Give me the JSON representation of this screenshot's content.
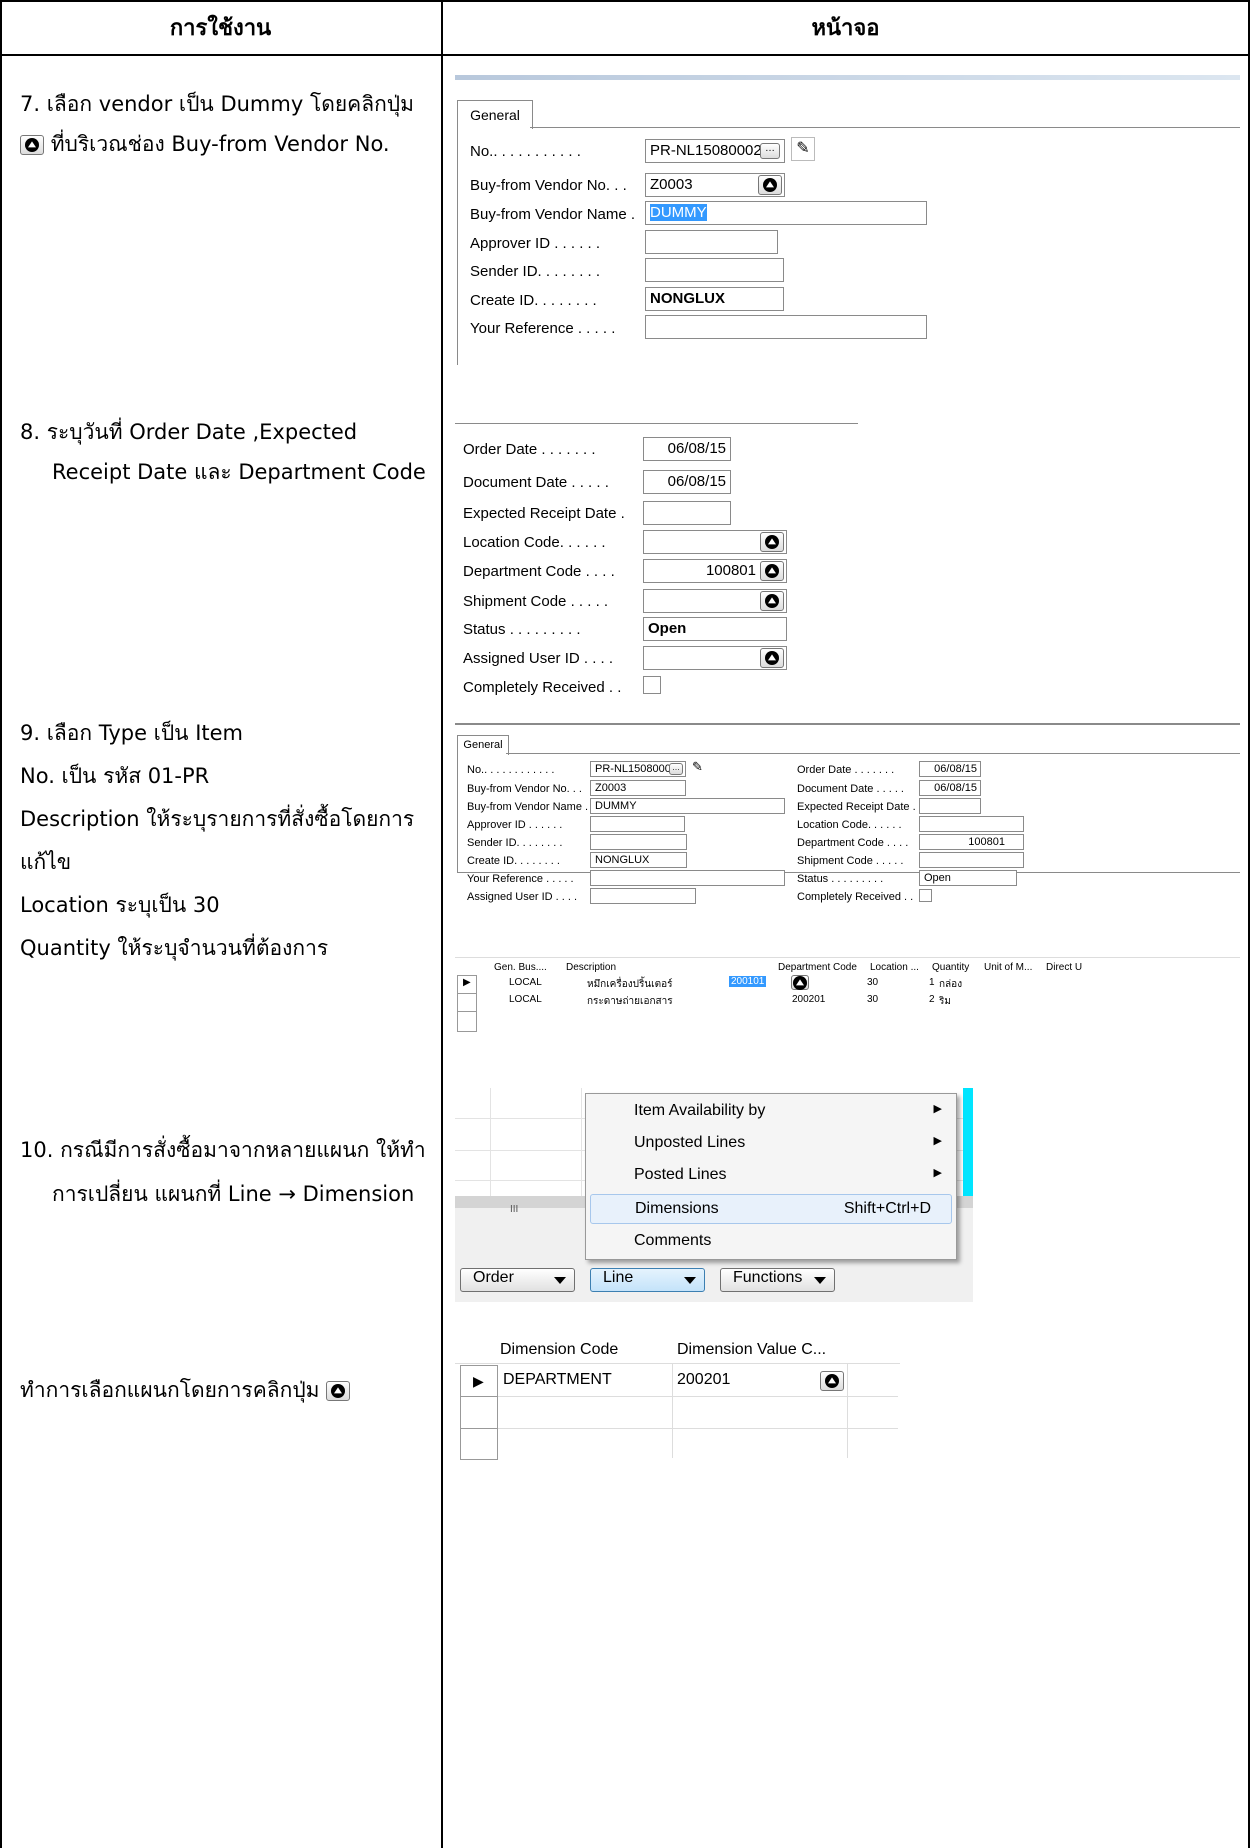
{
  "header": {
    "col1": "การใช้งาน",
    "col2": "หน้าจอ"
  },
  "steps": {
    "s7_line1": "7.  เลือก vendor เป็น Dummy โดยคลิกปุ่ม",
    "s7_line2": "ที่บริเวณช่อง Buy-from Vendor No.",
    "s8_line1": "8.  ระบุวันที่ Order Date ,Expected",
    "s8_line2": "Receipt Date และ Department Code",
    "s9_line1": "9.  เลือก Type เป็น Item",
    "s9_line2": "No. เป็น รหัส 01-PR",
    "s9_line3": "Description ให้ระบุรายการที่สั่งซื้อโดยการ",
    "s9_line4": "แก้ไข",
    "s9_line5": "Location ระบุเป็น 30",
    "s9_line6": "Quantity ให้ระบุจำนวนที่ต้องการ",
    "s10_line1": "10. กรณีมีการสั่งซื้อมาจากหลายแผนก ให้ทำ",
    "s10_line2": "การเปลี่ยน แผนกที่ Line → Dimension",
    "s11_line1": "ทำการเลือกแผนกโดยการคลิกปุ่ม"
  },
  "shot1": {
    "tab": "General",
    "no_label": "No.. . . . . . . . . . .",
    "no_value": "PR-NL15080002",
    "vendor_no_label": "Buy-from Vendor No. . .",
    "vendor_no_value": "Z0003",
    "vendor_name_label": "Buy-from Vendor Name .",
    "vendor_name_value": "DUMMY",
    "approver_label": "Approver ID . . . . . .",
    "sender_label": "Sender ID. . . . . . . .",
    "create_label": "Create ID. . . . . . . .",
    "create_value": "NONGLUX",
    "yourref_label": "Your Reference . . . . ."
  },
  "shot2": {
    "order_date_label": "Order Date . . . . . . .",
    "order_date_value": "06/08/15",
    "doc_date_label": "Document Date . . . . .",
    "doc_date_value": "06/08/15",
    "exp_label": "Expected Receipt Date .",
    "loc_label": "Location Code. . . . . .",
    "dept_label": "Department Code . . . .",
    "dept_value": "100801",
    "ship_label": "Shipment Code . . . . .",
    "status_label": "Status . . . . . . . . .",
    "status_value": "Open",
    "assigned_label": "Assigned User ID . . . .",
    "completely_label": "Completely Received . ."
  },
  "shot3": {
    "tab": "General",
    "no_label": "No.. . . . . . . . . . . .",
    "no_value": "PR-NL15080002",
    "vendor_no_label": "Buy-from Vendor No. . .",
    "vendor_no_value": "Z0003",
    "vendor_name_label": "Buy-from Vendor Name .",
    "vendor_name_value": "DUMMY",
    "approver_label": "Approver ID . . . . . .",
    "sender_label": "Sender ID. . . . . . . .",
    "create_label": "Create ID. . . . . . . .",
    "create_value": "NONGLUX",
    "yourref_label": "Your Reference . . . . .",
    "assigned_label": "Assigned User ID . . . .",
    "order_date_label": "Order Date . . . . . . .",
    "order_date_value": "06/08/15",
    "doc_date_label": "Document Date . . . . .",
    "doc_date_value": "06/08/15",
    "exp_label": "Expected Receipt Date .",
    "loc_label": "Location Code. . . . . .",
    "dept_label": "Department Code . . . .",
    "dept_value": "100801",
    "ship_label": "Shipment Code . . . . .",
    "status_label": "Status . . . . . . . . .",
    "status_value": "Open",
    "completely_label": "Completely Received . .",
    "lines_headers": [
      "Gen. Bus....",
      "Description",
      "Department Code",
      "Location ...",
      "Quantity",
      "Unit of M...",
      "Direct U"
    ],
    "lines": [
      {
        "gen": "LOCAL",
        "desc": "หมึกเครื่องปริ้นเตอร์",
        "dept": "200101",
        "loc": "30",
        "qty": "1",
        "uom": "กล่อง"
      },
      {
        "gen": "LOCAL",
        "desc": "กระดาษถ่ายเอกสาร",
        "dept": "200201",
        "loc": "30",
        "qty": "2",
        "uom": "ริม"
      }
    ]
  },
  "shot4": {
    "menu_items": [
      "Item Availability by",
      "Unposted Lines",
      "Posted Lines",
      "Dimensions",
      "Comments"
    ],
    "dimensions_shortcut": "Shift+Ctrl+D",
    "scroll_mark": "III",
    "order_btn": "Order",
    "line_btn": "Line",
    "functions_btn": "Functions"
  },
  "shot5": {
    "col1": "Dimension Code",
    "col2": "Dimension Value C...",
    "row_code": "DEPARTMENT",
    "row_value": "200201"
  }
}
